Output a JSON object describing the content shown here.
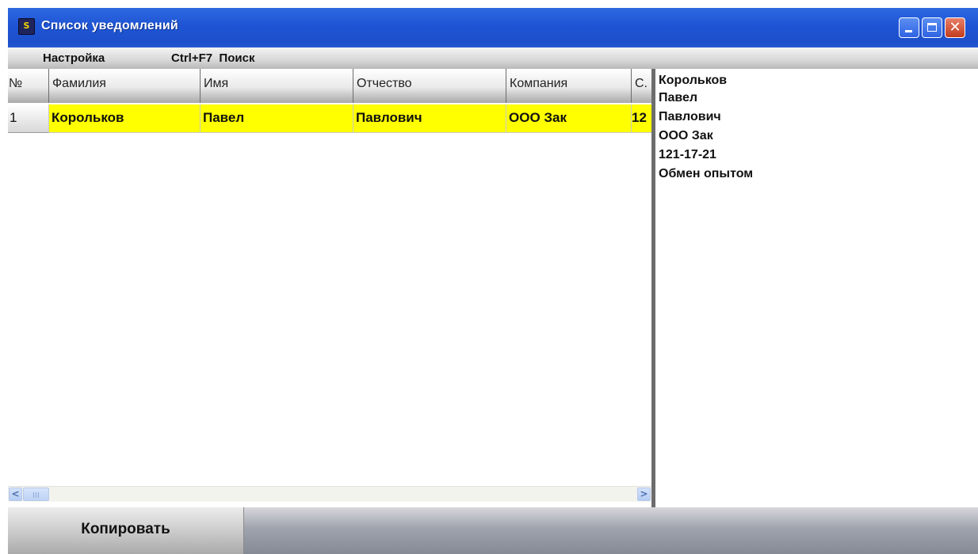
{
  "window": {
    "title": "Список уведомлений",
    "app_icon": "app-window-icon",
    "controls": {
      "minimize_icon": "minimize-icon",
      "maximize_icon": "maximize-icon",
      "close_icon": "close-icon",
      "close_glyph": "✕"
    }
  },
  "menu": {
    "settings": "Настройка",
    "search": "Ctrl+F7  Поиск"
  },
  "table": {
    "headers": [
      "№",
      "Фамилия",
      "Имя",
      "Отчество",
      "Компания",
      "С."
    ],
    "rows": [
      {
        "num": "1",
        "last_name": "Корольков",
        "first_name": "Павел",
        "patronymic": "Павлович",
        "company": "ООО Зак",
        "extra": "12"
      }
    ],
    "selected_row_color": "#ffff00"
  },
  "details": [
    "Корольков",
    "Павел",
    "Павлович",
    "ООО Зак",
    "121-17-21",
    "Обмен опытом"
  ],
  "scrollbar": {
    "left_glyph": "<",
    "right_glyph": ">"
  },
  "footer": {
    "copy_label": "Копировать"
  },
  "colors": {
    "title_bar": "#1f56d6",
    "close_button": "#c23c1c"
  }
}
